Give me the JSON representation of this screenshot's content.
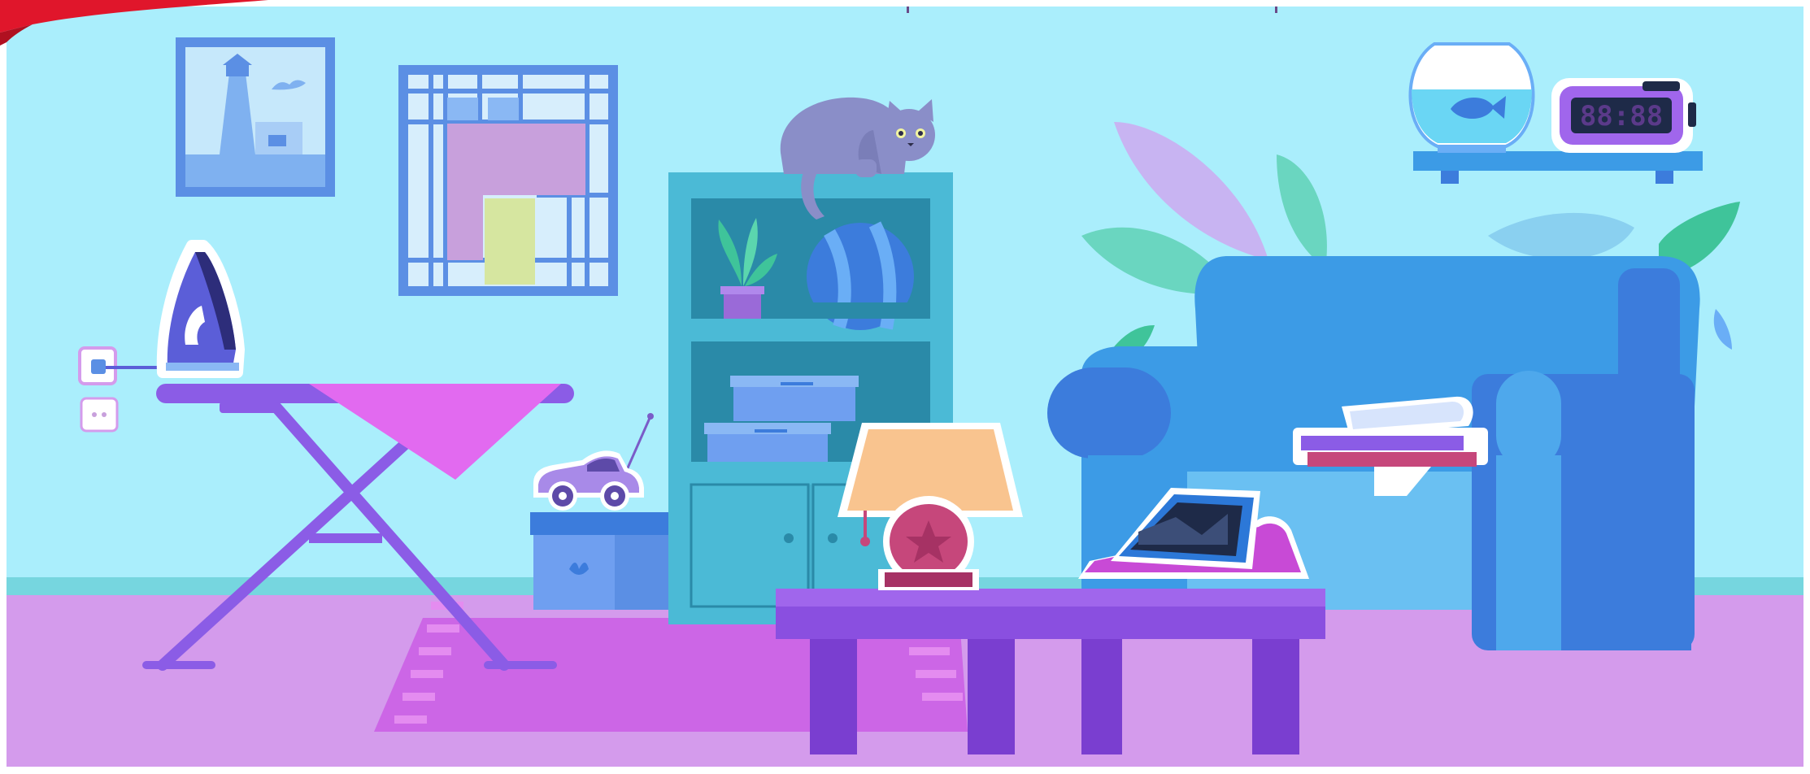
{
  "clock": {
    "display": "88:88"
  },
  "colors": {
    "wall": "#aaeefc",
    "floor": "#d49bec",
    "rug": "#cc66e6",
    "sofa": "#3c9be6",
    "table": "#8a4fe0",
    "shelf": "#4bbad6",
    "board_cover": "#e26af0",
    "board_frame": "#8b5ce6",
    "lamp_shade": "#f9c48f",
    "lamp_base": "#c6477b",
    "cat": "#8a8ec8",
    "corner_accent": "#e0162b"
  },
  "icons": {
    "window_frame": "painting-icon",
    "grid_artwork": "painting-icon",
    "iron": "iron-icon",
    "socket": "socket-icon",
    "cat": "cat-icon",
    "ball": "ball-icon",
    "plant": "plant-icon",
    "toy_car": "toy-car-icon",
    "fishbowl": "fishbowl-icon",
    "clock": "alarm-clock-icon",
    "lamp": "lamp-icon",
    "tablet": "tablet-icon",
    "books": "books-icon",
    "sofa": "sofa-icon",
    "table": "table-icon"
  }
}
